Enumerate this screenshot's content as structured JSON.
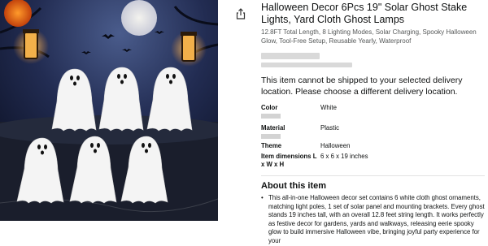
{
  "product": {
    "title": "Halloween Decor 6Pcs 19\" Solar Ghost Stake Lights, Yard Cloth Ghost Lamps",
    "subtitle": "12.8FT Total Length, 8 Lighting Modes, Solar Charging, Spooky Halloween Glow, Tool-Free Setup, Reusable Yearly, Waterproof",
    "delivery_notice": "This item cannot be shipped to your selected delivery location. Please choose a different delivery location."
  },
  "attributes": [
    {
      "key": "Color",
      "value": "White"
    },
    {
      "key": "Material",
      "value": "Plastic"
    },
    {
      "key": "Theme",
      "value": "Halloween"
    },
    {
      "key": "Item dimensions L x W x H",
      "value": "6 x 6 x 19 inches"
    }
  ],
  "about": {
    "heading": "About this item",
    "bullet": "This all-in-one Halloween decor set contains 6 white cloth ghost ornaments, matching light poles, 1 set of solar panel and mounting brackets. Every ghost stands 19 inches tall, with an overall 12.8 feet string length. It works perfectly as festive decor for gardens, yards and walkways, releasing eerie spooky glow to build immersive Halloween vibe, bringing joyful party experience for your"
  },
  "icons": {
    "share": "share-icon"
  },
  "colors": {
    "text": "#0f1111",
    "muted": "#565959",
    "night_sky": "#131a33"
  }
}
